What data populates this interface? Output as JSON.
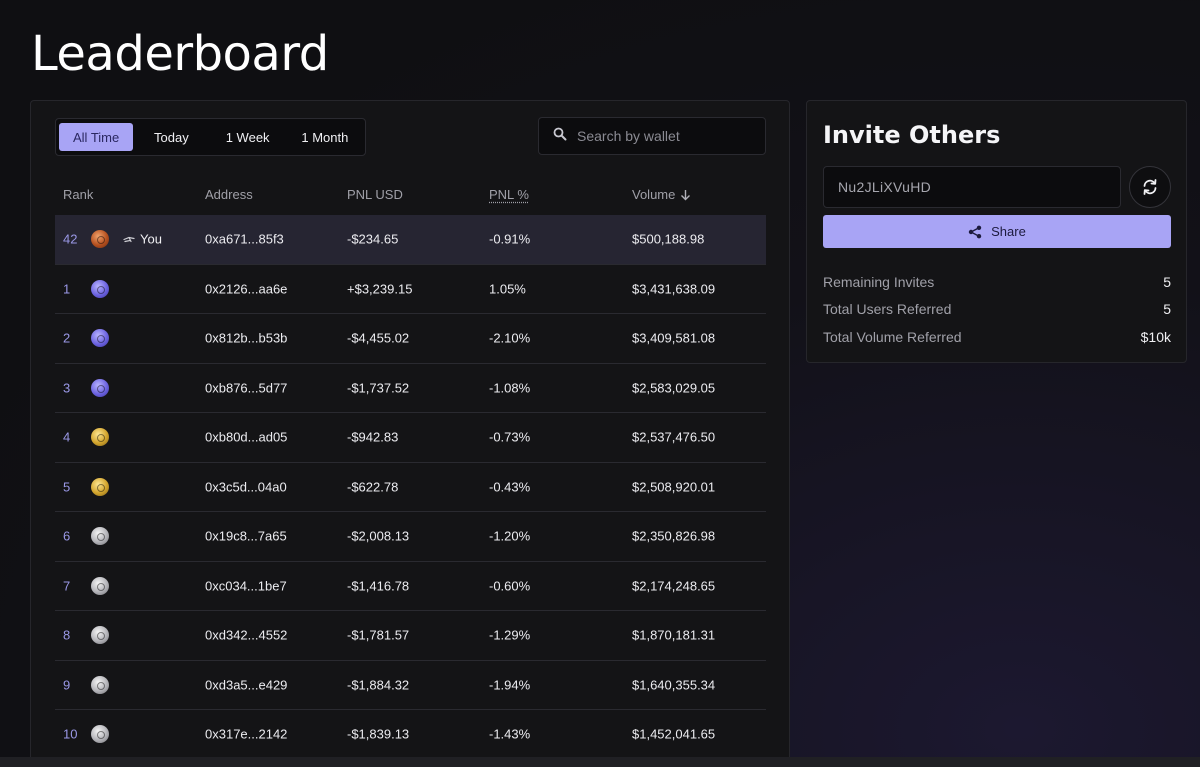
{
  "page": {
    "title": "Leaderboard"
  },
  "tabs": [
    {
      "label": "All Time",
      "active": true
    },
    {
      "label": "Today",
      "active": false
    },
    {
      "label": "1 Week",
      "active": false
    },
    {
      "label": "1 Month",
      "active": false
    }
  ],
  "search": {
    "placeholder": "Search by wallet",
    "icon": "search-icon"
  },
  "table": {
    "headers": {
      "rank": "Rank",
      "address": "Address",
      "pnl_usd": "PNL USD",
      "pnl_pct": "PNL %",
      "volume": "Volume"
    },
    "sort": {
      "column": "volume",
      "direction": "desc"
    },
    "you_label": "You",
    "rows": [
      {
        "rank": "42",
        "medal": "bronze",
        "is_you": true,
        "address": "0xa671...85f3",
        "pnl_usd": "-$234.65",
        "pnl_pct": "-0.91%",
        "volume": "$500,188.98"
      },
      {
        "rank": "1",
        "medal": "purple",
        "address": "0x2126...aa6e",
        "pnl_usd": "+$3,239.15",
        "pnl_pct": "1.05%",
        "volume": "$3,431,638.09"
      },
      {
        "rank": "2",
        "medal": "purple",
        "address": "0x812b...b53b",
        "pnl_usd": "-$4,455.02",
        "pnl_pct": "-2.10%",
        "volume": "$3,409,581.08"
      },
      {
        "rank": "3",
        "medal": "purple",
        "address": "0xb876...5d77",
        "pnl_usd": "-$1,737.52",
        "pnl_pct": "-1.08%",
        "volume": "$2,583,029.05"
      },
      {
        "rank": "4",
        "medal": "gold",
        "address": "0xb80d...ad05",
        "pnl_usd": "-$942.83",
        "pnl_pct": "-0.73%",
        "volume": "$2,537,476.50"
      },
      {
        "rank": "5",
        "medal": "gold",
        "address": "0x3c5d...04a0",
        "pnl_usd": "-$622.78",
        "pnl_pct": "-0.43%",
        "volume": "$2,508,920.01"
      },
      {
        "rank": "6",
        "medal": "silver",
        "address": "0x19c8...7a65",
        "pnl_usd": "-$2,008.13",
        "pnl_pct": "-1.20%",
        "volume": "$2,350,826.98"
      },
      {
        "rank": "7",
        "medal": "silver",
        "address": "0xc034...1be7",
        "pnl_usd": "-$1,416.78",
        "pnl_pct": "-0.60%",
        "volume": "$2,174,248.65"
      },
      {
        "rank": "8",
        "medal": "silver",
        "address": "0xd342...4552",
        "pnl_usd": "-$1,781.57",
        "pnl_pct": "-1.29%",
        "volume": "$1,870,181.31"
      },
      {
        "rank": "9",
        "medal": "silver",
        "address": "0xd3a5...e429",
        "pnl_usd": "-$1,884.32",
        "pnl_pct": "-1.94%",
        "volume": "$1,640,355.34"
      },
      {
        "rank": "10",
        "medal": "silver",
        "address": "0x317e...2142",
        "pnl_usd": "-$1,839.13",
        "pnl_pct": "-1.43%",
        "volume": "$1,452,041.65"
      }
    ]
  },
  "invite": {
    "title": "Invite Others",
    "code": "Nu2JLiXVuHD",
    "share_label": "Share",
    "stats": [
      {
        "label": "Remaining Invites",
        "value": "5"
      },
      {
        "label": "Total Users Referred",
        "value": "5"
      },
      {
        "label": "Total Volume Referred",
        "value": "$10k"
      }
    ]
  },
  "colors": {
    "accent": "#a8a4f5",
    "background": "#101013",
    "panel": "#141416",
    "you_row": "#262532"
  }
}
